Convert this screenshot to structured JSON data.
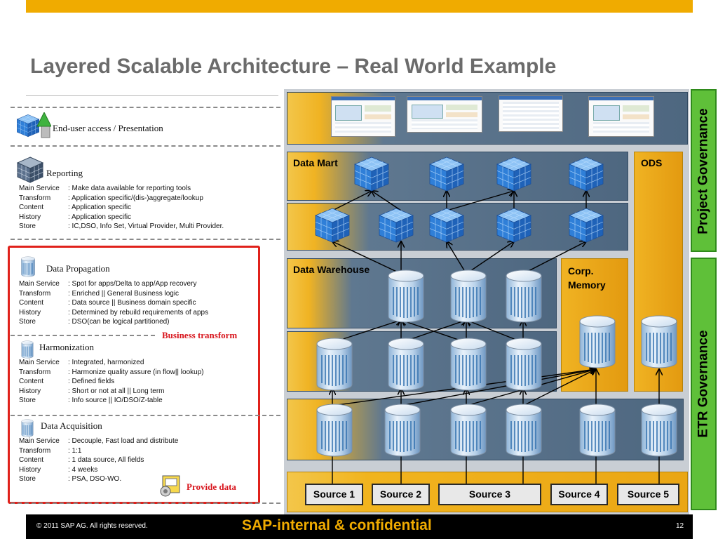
{
  "slide": {
    "title": "Layered Scalable Architecture – Real World Example"
  },
  "left_panel": {
    "presentation": {
      "label": "End-user access / Presentation"
    },
    "reporting": {
      "label": "Reporting",
      "rows": [
        {
          "key": "Main Service",
          "value": ": Make data available for reporting tools"
        },
        {
          "key": "Transform",
          "value": ": Application specific/(dis-)aggregate/lookup"
        },
        {
          "key": "Content",
          "value": ": Application specific"
        },
        {
          "key": "History",
          "value": ": Application specific"
        },
        {
          "key": "Store",
          "value": ": IC,DSO, Info Set, Virtual Provider, Multi Provider."
        }
      ]
    },
    "propagation": {
      "label": "Data Propagation",
      "rows": [
        {
          "key": "Main Service",
          "value": ": Spot for apps/Delta to app/App recovery"
        },
        {
          "key": "Transform",
          "value": ": Enriched || General Business logic"
        },
        {
          "key": "Content",
          "value": ": Data source || Business domain specific"
        },
        {
          "key": "History",
          "value": ": Determined by rebuild requirements of apps"
        },
        {
          "key": "Store",
          "value": ": DSO(can be logical partitioned)"
        }
      ]
    },
    "business_transform_label": "Business transform",
    "harmonization": {
      "label": "Harmonization",
      "rows": [
        {
          "key": "Main Service",
          "value": ": Integrated, harmonized"
        },
        {
          "key": "Transform",
          "value": ": Harmonize quality assure (in flow|| lookup)"
        },
        {
          "key": "Content",
          "value": ": Defined fields"
        },
        {
          "key": "History",
          "value": ": Short or not at all || Long term"
        },
        {
          "key": "Store",
          "value": ": Info source || IO/DSO/Z-table"
        }
      ]
    },
    "acquisition": {
      "label": "Data Acquisition",
      "rows": [
        {
          "key": "Main Service",
          "value": ": Decouple, Fast load and distribute"
        },
        {
          "key": "Transform",
          "value": ": 1:1"
        },
        {
          "key": "Content",
          "value": ": 1 data source, All fields"
        },
        {
          "key": "History",
          "value": ": 4 weeks"
        },
        {
          "key": "Store",
          "value": ": PSA, DSO-WO."
        }
      ]
    },
    "provide_data_label": "Provide data"
  },
  "diagram": {
    "data_mart_label": "Data Mart",
    "ods_label": "ODS",
    "data_warehouse_label": "Data Warehouse",
    "corp_memory_label_line1": "Corp.",
    "corp_memory_label_line2": "Memory",
    "sources": [
      "Source 1",
      "Source 2",
      "Source 3",
      "Source 4",
      "Source 5"
    ],
    "governance": {
      "project": "Project Governance",
      "etr": "ETR Governance"
    },
    "colors": {
      "accent": "#f0ab00",
      "governance_green": "#5fc039",
      "band_blue": "#4e6780",
      "highlight_red": "#e0211b"
    }
  },
  "footer": {
    "copyright": "© 2011 SAP AG. All rights reserved.",
    "confidential": "SAP-internal & confidential",
    "page_number": "12"
  }
}
